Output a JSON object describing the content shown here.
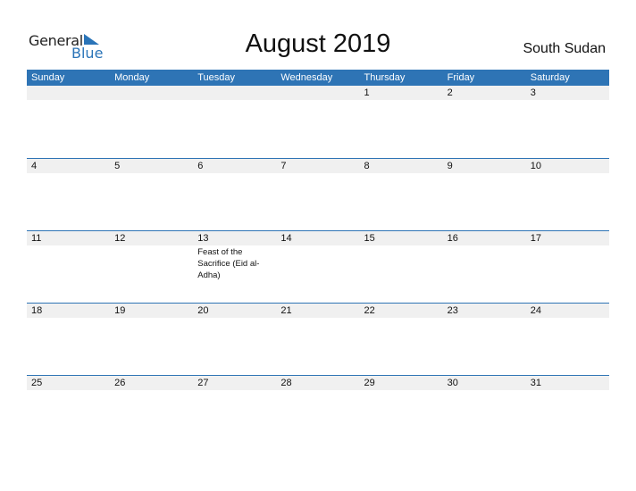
{
  "logo": {
    "word1": "General",
    "word2": "Blue",
    "icon": "triangle-flag-icon",
    "brand_color": "#2a74b8"
  },
  "title": "August 2019",
  "country": "South Sudan",
  "header_color": "#2e74b5",
  "weekdays": [
    "Sunday",
    "Monday",
    "Tuesday",
    "Wednesday",
    "Thursday",
    "Friday",
    "Saturday"
  ],
  "weeks": [
    {
      "days": [
        "",
        "",
        "",
        "",
        "1",
        "2",
        "3"
      ],
      "events": [
        "",
        "",
        "",
        "",
        "",
        "",
        ""
      ]
    },
    {
      "days": [
        "4",
        "5",
        "6",
        "7",
        "8",
        "9",
        "10"
      ],
      "events": [
        "",
        "",
        "",
        "",
        "",
        "",
        ""
      ]
    },
    {
      "days": [
        "11",
        "12",
        "13",
        "14",
        "15",
        "16",
        "17"
      ],
      "events": [
        "",
        "",
        "Feast of the Sacrifice (Eid al-Adha)",
        "",
        "",
        "",
        ""
      ]
    },
    {
      "days": [
        "18",
        "19",
        "20",
        "21",
        "22",
        "23",
        "24"
      ],
      "events": [
        "",
        "",
        "",
        "",
        "",
        "",
        ""
      ]
    },
    {
      "days": [
        "25",
        "26",
        "27",
        "28",
        "29",
        "30",
        "31"
      ],
      "events": [
        "",
        "",
        "",
        "",
        "",
        "",
        ""
      ]
    }
  ]
}
